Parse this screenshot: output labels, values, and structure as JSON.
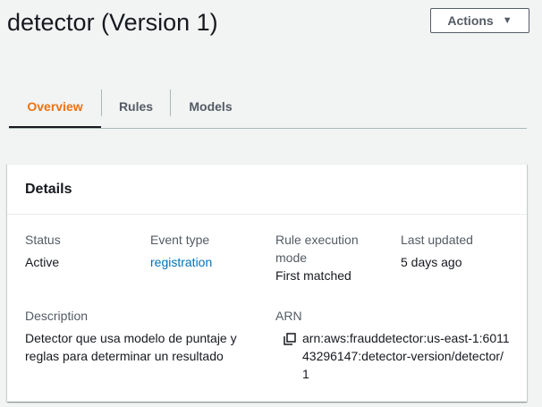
{
  "header": {
    "title": "detector (Version 1)",
    "actions_label": "Actions"
  },
  "tabs": [
    {
      "label": "Overview",
      "active": true
    },
    {
      "label": "Rules",
      "active": false
    },
    {
      "label": "Models",
      "active": false
    }
  ],
  "details": {
    "title": "Details",
    "status": {
      "label": "Status",
      "value": "Active"
    },
    "event_type": {
      "label": "Event type",
      "value": "registration"
    },
    "rule_execution_mode": {
      "label": "Rule execution mode",
      "value": "First matched"
    },
    "last_updated": {
      "label": "Last updated",
      "value": "5 days ago"
    },
    "description": {
      "label": "Description",
      "value": "Detector que usa modelo de puntaje y reglas para determinar un resultado"
    },
    "arn": {
      "label": "ARN",
      "value": "arn:aws:frauddetector:us-east-1:601143296147:detector-version/detector/1"
    }
  },
  "colors": {
    "accent": "#ec7211",
    "link": "#0073bb",
    "background": "#f2f3f3"
  },
  "icons": {
    "actions_caret": "caret-down-icon",
    "arn_copy": "copy-icon"
  }
}
